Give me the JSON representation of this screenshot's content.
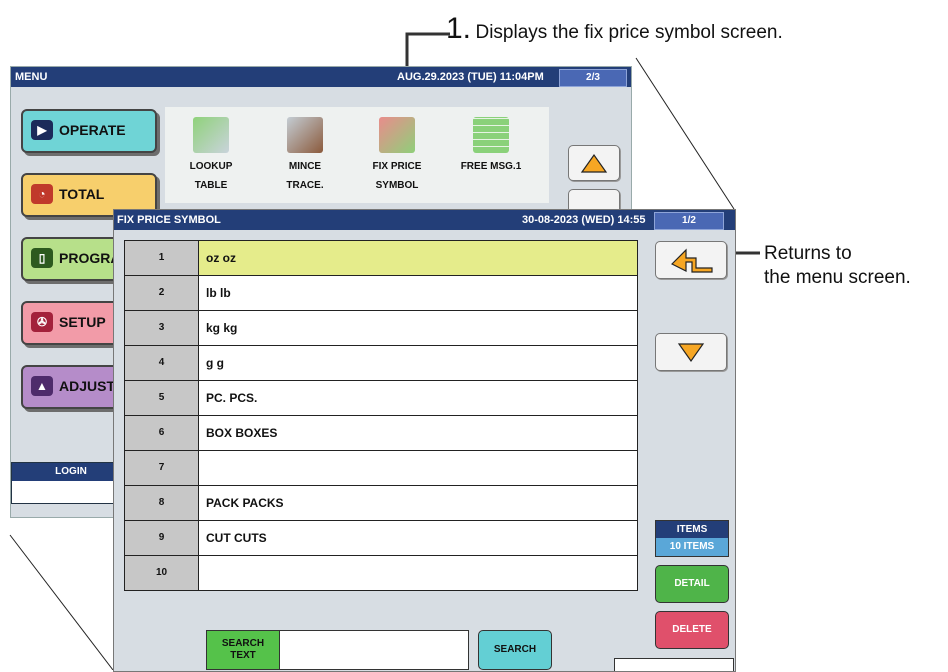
{
  "callouts": {
    "step_number": "1.",
    "step_text": "Displays the fix price symbol screen.",
    "return_line1": "Returns to",
    "return_line2": "the menu screen."
  },
  "menu_screen": {
    "title": "MENU",
    "datetime": "AUG.29.2023 (TUE) 11:04PM",
    "page": "2/3",
    "buttons": [
      {
        "label": "OPERATE",
        "color": "#6fd4d6"
      },
      {
        "label": "TOTAL",
        "color": "#f7cf6c"
      },
      {
        "label": "PROGRAM",
        "color": "#b7e08a"
      },
      {
        "label": "SETUP",
        "color": "#f29ba8"
      },
      {
        "label": "ADJUST",
        "color": "#b58cc9"
      }
    ],
    "icons": [
      {
        "line1": "LOOKUP",
        "line2": "TABLE"
      },
      {
        "line1": "MINCE",
        "line2": "TRACE."
      },
      {
        "line1": "FIX PRICE",
        "line2": "SYMBOL"
      },
      {
        "line1": "FREE MSG.1",
        "line2": ""
      }
    ],
    "login_label": "LOGIN"
  },
  "fps_screen": {
    "title": "FIX PRICE SYMBOL",
    "datetime": "30-08-2023 (WED) 14:55",
    "page": "1/2",
    "rows": [
      {
        "num": "1",
        "val": "oz oz"
      },
      {
        "num": "2",
        "val": "lb lb"
      },
      {
        "num": "3",
        "val": "kg kg"
      },
      {
        "num": "4",
        "val": "g g"
      },
      {
        "num": "5",
        "val": "PC. PCS."
      },
      {
        "num": "6",
        "val": "BOX BOXES"
      },
      {
        "num": "7",
        "val": ""
      },
      {
        "num": "8",
        "val": "PACK PACKS"
      },
      {
        "num": "9",
        "val": "CUT CUTS"
      },
      {
        "num": "10",
        "val": ""
      }
    ],
    "items_label": "ITEMS",
    "items_count": "10 ITEMS",
    "detail_label": "DETAIL",
    "delete_label": "DELETE",
    "search_text_line1": "SEARCH",
    "search_text_line2": "TEXT",
    "search_label": "SEARCH",
    "colors": {
      "title_bar": "#233e78",
      "selected_row": "#e5ec8b",
      "detail": "#4fb449",
      "delete": "#e0506b",
      "items": "#5aa7d8"
    }
  }
}
